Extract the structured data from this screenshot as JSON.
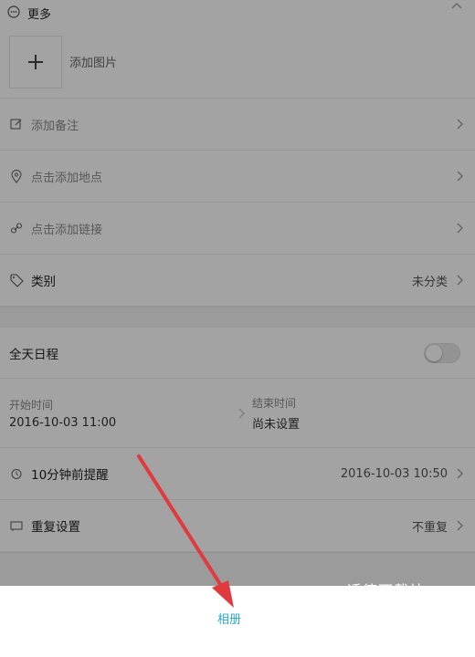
{
  "header": {
    "title": "更多"
  },
  "image_add": {
    "label": "添加图片"
  },
  "items": {
    "note": {
      "label": "添加备注"
    },
    "location": {
      "label": "点击添加地点"
    },
    "link": {
      "label": "点击添加链接"
    },
    "category": {
      "label": "类别",
      "value": "未分类"
    }
  },
  "all_day": {
    "label": "全天日程",
    "enabled": false
  },
  "time": {
    "start_caption": "开始时间",
    "start_value": "2016-10-03 11:00",
    "end_caption": "结束时间",
    "end_value": "尚未设置"
  },
  "reminder": {
    "label": "10分钟前提醒",
    "value": "2016-10-03 10:50"
  },
  "repeat": {
    "label": "重复设置",
    "value": "不重复"
  },
  "bottom_sheet": {
    "album_label": "相册"
  },
  "watermark": {
    "text": "适德下载站"
  },
  "colors": {
    "accent": "#2aa9c9",
    "arrow": "#e03a3e",
    "overlay": "rgba(0,0,0,0.36)"
  }
}
